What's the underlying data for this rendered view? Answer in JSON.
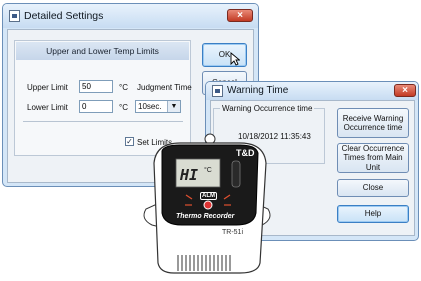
{
  "settings_dialog": {
    "title": "Detailed Settings",
    "close_glyph": "×",
    "group_title": "Upper and Lower Temp Limits",
    "upper_limit": {
      "label": "Upper Limit",
      "value": "50",
      "unit": "°C"
    },
    "lower_limit": {
      "label": "Lower Limit",
      "value": "0",
      "unit": "°C"
    },
    "judgment_time": {
      "label": "Judgment Time",
      "selected": "10sec."
    },
    "set_limits": {
      "label": "Set Limits",
      "checked": true
    },
    "ok_label": "OK",
    "cancel_label": "Cancel"
  },
  "warning_dialog": {
    "title": "Warning Time",
    "close_glyph": "×",
    "group_title": "Warning Occurrence time",
    "occurrence_time": "10/18/2012 11:35:43",
    "buttons": {
      "receive": "Receive Warning Occurrence time",
      "clear": "Clear Occurrence Times from Main Unit",
      "close": "Close",
      "help": "Help"
    }
  },
  "device": {
    "brand": "T&D",
    "display_reading": "HI",
    "display_unit": "°C",
    "indicator": "ALM",
    "product_line": "Thermo Recorder",
    "model": "TR-51i"
  }
}
